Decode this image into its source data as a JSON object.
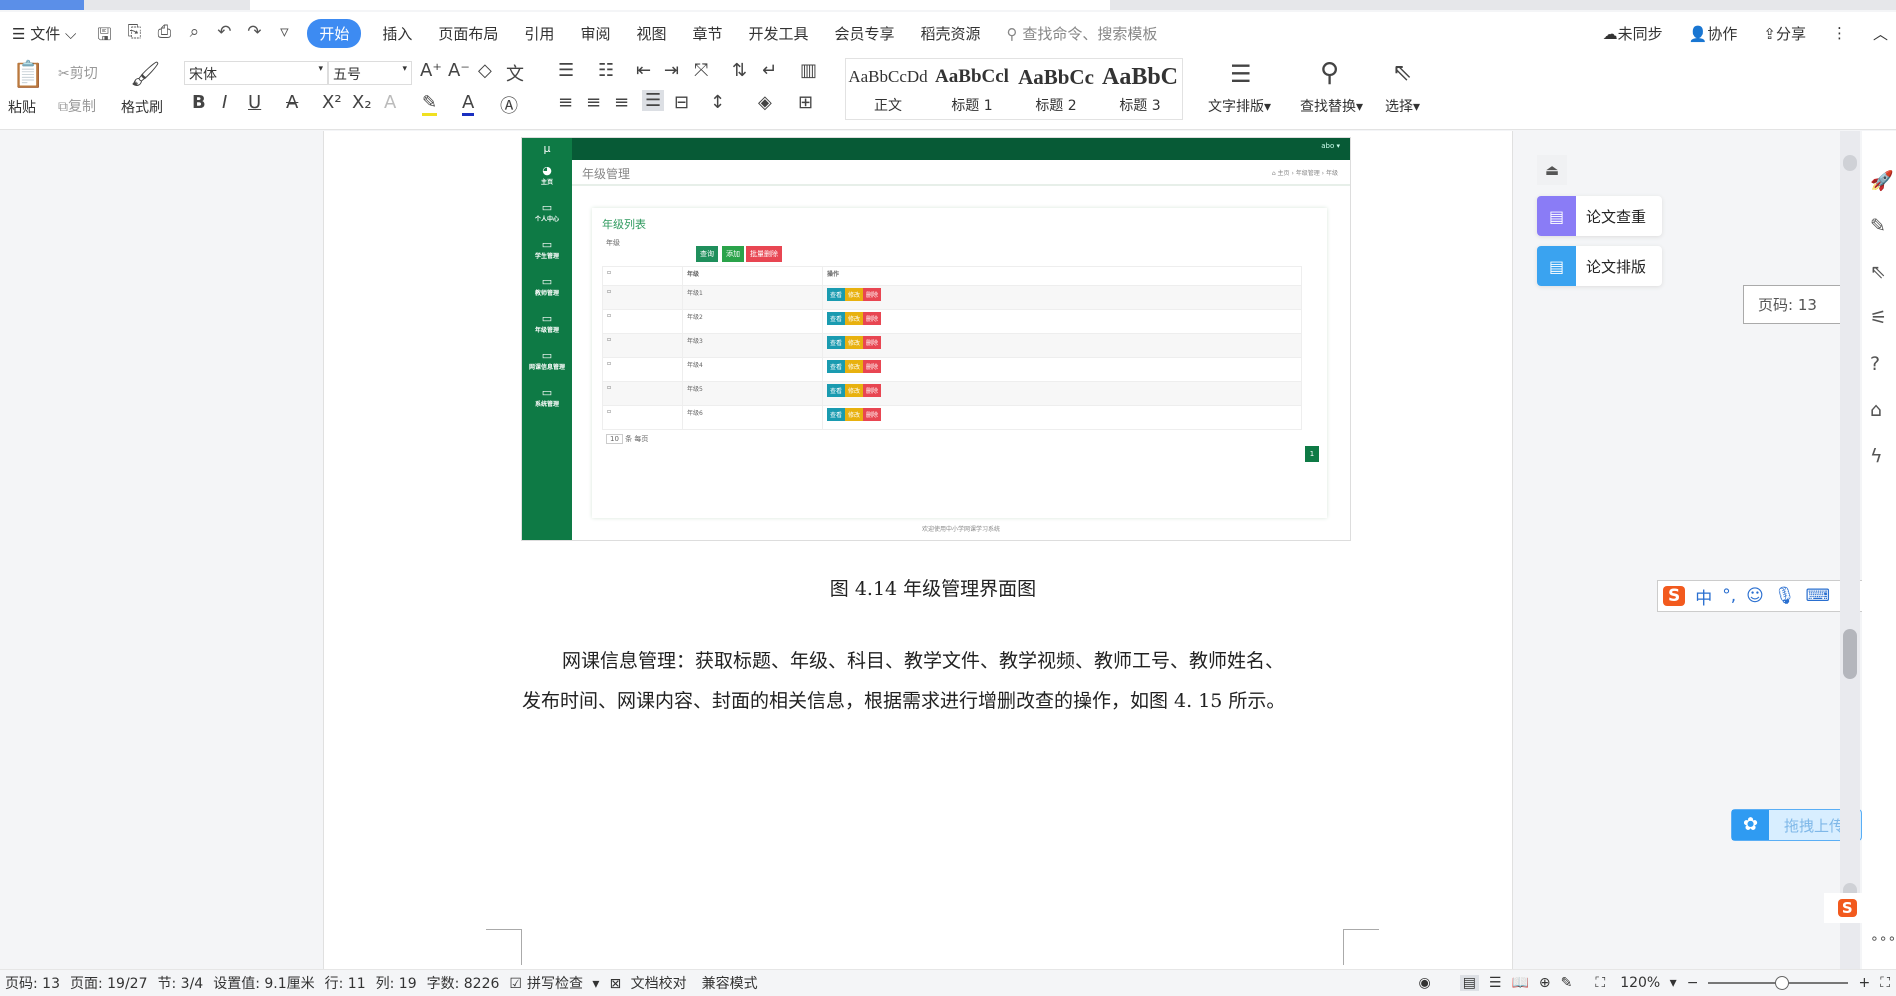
{
  "menubar": {
    "file": "文件",
    "items": [
      "开始",
      "插入",
      "页面布局",
      "引用",
      "审阅",
      "视图",
      "章节",
      "开发工具",
      "会员专享",
      "稻壳资源"
    ],
    "active": "开始",
    "search_placeholder": "查找命令、搜索模板",
    "sync": "未同步",
    "collab": "协作",
    "share": "分享"
  },
  "ribbon": {
    "paste": "粘贴",
    "cut": "剪切",
    "copy": "复制",
    "format_painter": "格式刷",
    "font": "宋体",
    "size": "五号",
    "styles": [
      {
        "sample": "AaBbCcDd",
        "label": "正文"
      },
      {
        "sample": "AaBbCcl",
        "label": "标题 1"
      },
      {
        "sample": "AaBbCc",
        "label": "标题 2"
      },
      {
        "sample": "AaBbC",
        "label": "标题 3"
      }
    ],
    "text_layout": "文字排版",
    "find_replace": "查找替换",
    "select": "选择"
  },
  "screenshot": {
    "logo": "μ",
    "user": "abo ▾",
    "page_title": "年级管理",
    "breadcrumb": "⌂ 主页 › 年级管理 › 年级",
    "sidebar": [
      "主页",
      "个人中心",
      "学生管理",
      "教师管理",
      "年级管理",
      "网课信息管理",
      "系统管理"
    ],
    "card_title": "年级列表",
    "filter_label": "年级",
    "buttons": {
      "query": "查询",
      "add": "添加",
      "batch_delete": "批量删除"
    },
    "columns": [
      "年级",
      "操作"
    ],
    "rows": [
      "年级1",
      "年级2",
      "年级3",
      "年级4",
      "年级5",
      "年级6"
    ],
    "row_actions": {
      "view": "查看",
      "edit": "修改",
      "delete": "删除"
    },
    "page_size": "10",
    "page_size_suffix": "条 每页",
    "page": "1",
    "footer": "欢迎使用中小学网课学习系统"
  },
  "document": {
    "caption": "图 4.14 年级管理界面图",
    "para_line1": "网课信息管理：获取标题、年级、科目、教学文件、教学视频、教师工号、教师姓名、",
    "para_line2": "发布时间、网课内容、封面的相关信息，根据需求进行增删改查的操作，如图 4. 15 所示。"
  },
  "right_panel": {
    "check": "论文查重",
    "layout": "论文排版",
    "page_tip": "页码: 13",
    "upload": "拖拽上传",
    "check_color": "#8a7cf6",
    "layout_color": "#3aa3f0"
  },
  "status": {
    "page": "页码: 13",
    "pages": "页面: 19/27",
    "section": "节: 3/4",
    "setting": "设置值: 9.1厘米",
    "row": "行: 11",
    "col": "列: 19",
    "words": "字数: 8226",
    "spell": "拼写检查",
    "proof": "文档校对",
    "compat": "兼容模式",
    "zoom": "120%",
    "zoom_level": 120
  },
  "ime": {
    "lang": "中"
  }
}
